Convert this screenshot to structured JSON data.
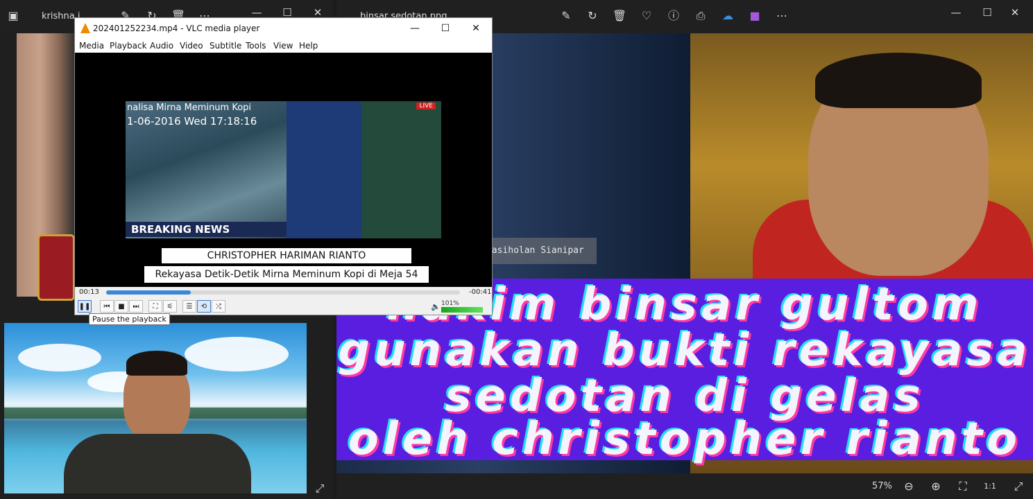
{
  "left_viewer": {
    "title": "krishna.j...",
    "toolbar_icons": [
      "image-icon",
      "edit-icon",
      "rotate-icon",
      "delete-icon",
      "more-icon"
    ],
    "expand_icon": "expand-icon"
  },
  "right_viewer": {
    "title": "binsar sedotan.png",
    "toolbar_icons": [
      "edit-icon",
      "rotate-icon",
      "delete-icon",
      "heart-icon",
      "info-icon",
      "print-icon",
      "onedrive-icon",
      "clipchamp-icon",
      "more-icon"
    ],
    "watermark": "Rismon Hasiholan Sianipar",
    "banner_lines": [
      "hakim binsar gultom",
      "gunakan bukti rekayasa",
      "sedotan di gelas",
      "oleh christopher rianto"
    ],
    "banner_color": "#5a1ee0",
    "zoom": "57%"
  },
  "vlc": {
    "title": "202401252234.mp4 - VLC media player",
    "menu": [
      "Media",
      "Playback",
      "Audio",
      "Video",
      "Subtitle",
      "Tools",
      "View",
      "Help"
    ],
    "video": {
      "headline": "nalisa Mirna Meminum Kopi",
      "date": "1-06-2016 Wed 17:18:16",
      "live": "LIVE",
      "breaking": "BREAKING NEWS",
      "caption_name": "CHRISTOPHER HARIMAN RIANTO",
      "caption_title": "Rekayasa Detik-Detik Mirna Meminum Kopi di Meja 54"
    },
    "elapsed": "00:13",
    "remaining": "-00:41",
    "progress": 0.24,
    "volume": "101%",
    "volume_level": 1.01,
    "tooltip": "Pause the playback"
  }
}
